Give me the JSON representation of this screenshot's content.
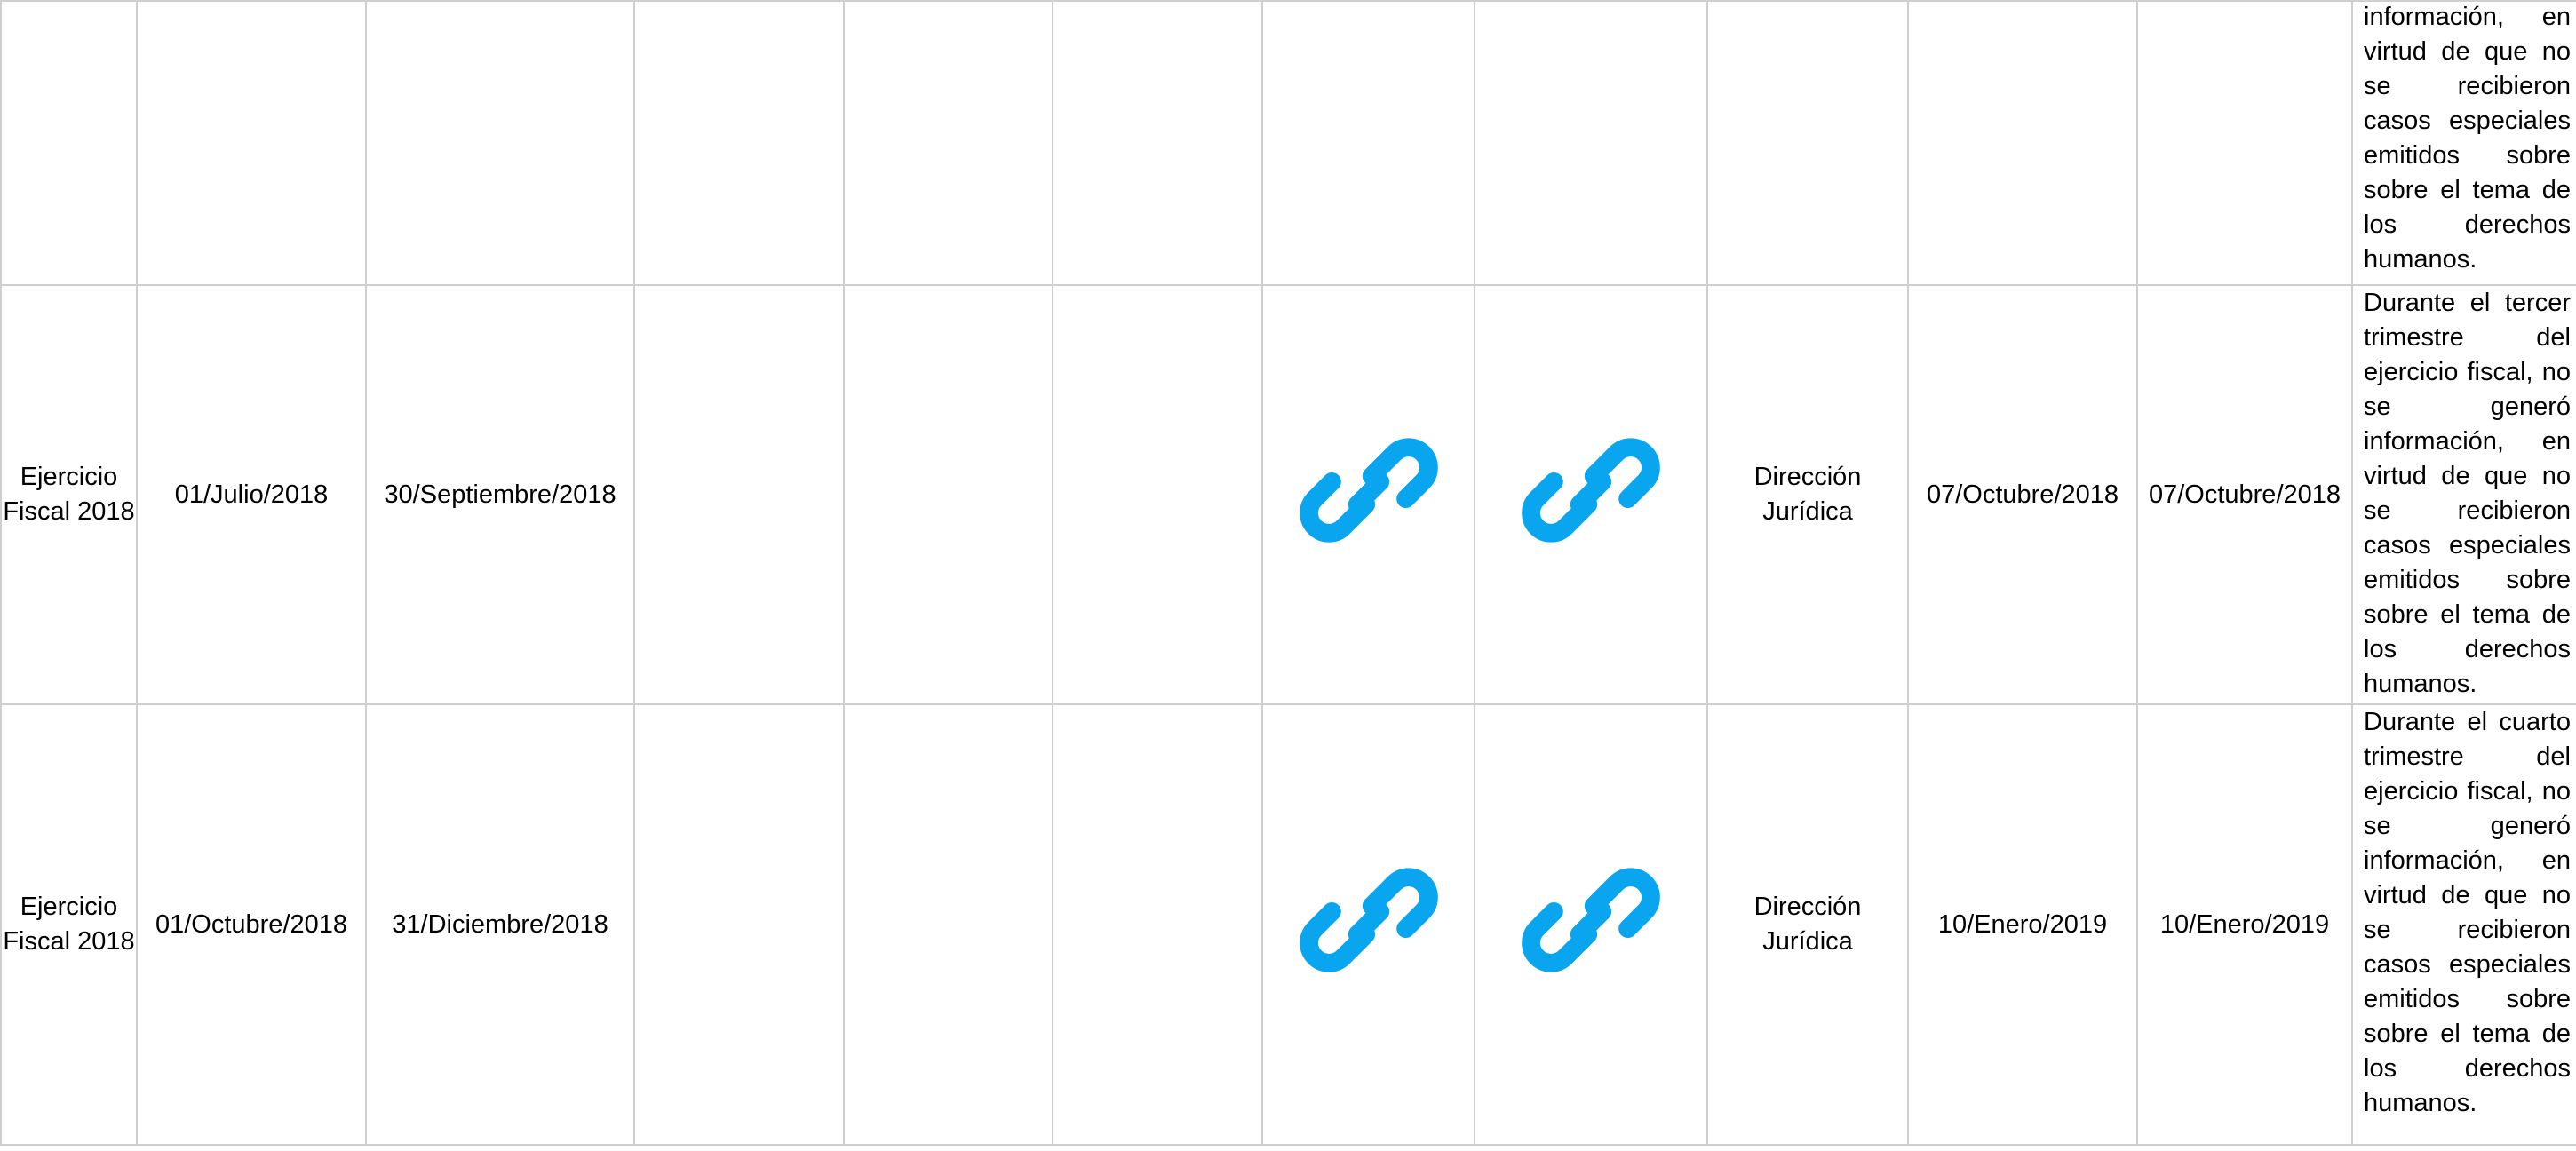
{
  "accent_color": "#0aa5ef",
  "rows": [
    {
      "periodo": "",
      "fecha_inicio": "",
      "fecha_termino": "",
      "hipervinculo_1": false,
      "hipervinculo_2": false,
      "area": "",
      "fecha_validacion": "",
      "fecha_actualizacion": "",
      "nota": "información, en virtud de que no se recibieron casos especiales emitidos sobre sobre el tema de los derechos humanos."
    },
    {
      "periodo": "Ejercicio Fiscal 2018",
      "fecha_inicio": "01/Julio/2018",
      "fecha_termino": "30/Septiembre/2018",
      "hipervinculo_1": true,
      "hipervinculo_2": true,
      "icon": "link-icon",
      "area": "Dirección Jurídica",
      "fecha_validacion": "07/Octubre/2018",
      "fecha_actualizacion": "07/Octubre/2018",
      "nota": "Durante el tercer trimestre del ejercicio fiscal, no se generó información, en virtud de que no se recibieron casos especiales emitidos sobre sobre el tema de los derechos humanos."
    },
    {
      "periodo": "Ejercicio Fiscal 2018",
      "fecha_inicio": "01/Octubre/2018",
      "fecha_termino": "31/Diciembre/2018",
      "hipervinculo_1": true,
      "hipervinculo_2": true,
      "icon": "link-icon",
      "area": "Dirección Jurídica",
      "fecha_validacion": "10/Enero/2019",
      "fecha_actualizacion": "10/Enero/2019",
      "nota": "Durante el cuarto trimestre del ejercicio fiscal, no se generó información, en virtud de que no se recibieron casos especiales emitidos sobre sobre el tema de los derechos humanos."
    }
  ]
}
